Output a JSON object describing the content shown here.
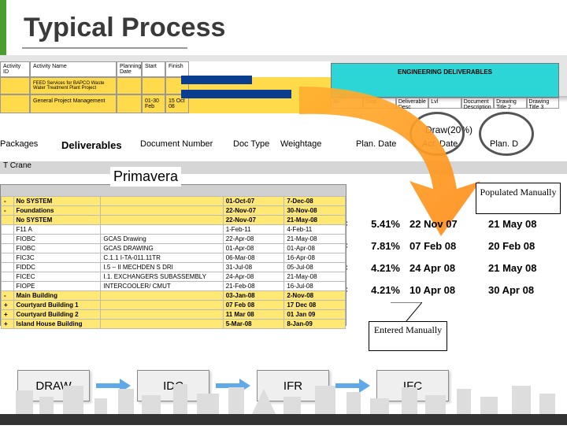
{
  "title": "Typical Process",
  "gantt": {
    "headers": [
      "Activity ID",
      "Activity Name",
      "Planning Date",
      "Start",
      "Finish"
    ],
    "rows": [
      [
        "",
        "FEED Services for BAPCO Waste Water Treatment Plant Project",
        "",
        "",
        ""
      ],
      [
        "",
        "General Project Management",
        "",
        "01-30 Feb",
        "15 Oct 08"
      ]
    ]
  },
  "cyan": {
    "title": "ENGINEERING DELIVERABLES",
    "cells": [
      "",
      "ID",
      "Disp",
      "Deliverable Desc",
      "Lvl",
      "Document Description",
      "Drawing Title 2",
      "Drawing Title 3"
    ]
  },
  "colhead": {
    "draw": "Draw(20%)",
    "cols": [
      "Packages",
      "Deliverables",
      "Document Number",
      "Doc Type",
      "Weightage",
      "Plan. Date",
      "Act. Date",
      "Plan. D"
    ]
  },
  "greyrow_label": "T Crane",
  "primavera_label": "Primavera",
  "populated_label": "Populated Manually",
  "entered_label": "Entered Manually",
  "pvwin": {
    "rows": [
      {
        "cls": "ylw",
        "cells": [
          "-",
          "No SYSTEM",
          "",
          "01-Oct-07",
          "7-Dec-08"
        ]
      },
      {
        "cls": "ylw",
        "cells": [
          "-",
          "Foundations",
          "",
          "22-Nov-07",
          "30-Nov-08"
        ]
      },
      {
        "cls": "ylw",
        "cells": [
          "",
          "No SYSTEM",
          "",
          "22-Nov-07",
          "21-May-08"
        ]
      },
      {
        "cls": "wht",
        "cells": [
          "",
          "F11 A",
          "",
          "1-Feb-11",
          "4-Feb-11"
        ]
      },
      {
        "cls": "wht",
        "cells": [
          "",
          "FIOBC",
          "GCAS Drawing",
          "22-Apr-08",
          "21-May-08"
        ]
      },
      {
        "cls": "wht",
        "cells": [
          "",
          "FIOBC",
          "GCAS DRAWING",
          "01-Apr-08",
          "01-Apr-08"
        ]
      },
      {
        "cls": "wht",
        "cells": [
          "",
          "FIC3C",
          "C.1.1 I-TA-011.11TR",
          "06-Mar-08",
          "16-Apr-08"
        ]
      },
      {
        "cls": "wht",
        "cells": [
          "",
          "FIDDC",
          "I.5 – II MECHDEN S DRI",
          "31-Jul-08",
          "05-Jul-08"
        ]
      },
      {
        "cls": "wht",
        "cells": [
          "",
          "FICEC",
          "I.1. EXCHANGERS SUBASSEMBLY",
          "24-Apr-08",
          "21-May-08"
        ]
      },
      {
        "cls": "wht",
        "cells": [
          "",
          "FIOPE",
          "INTERCOOLER/ CMUT",
          "21-Feb-08",
          "16-Jul-08"
        ]
      },
      {
        "cls": "ylw",
        "cells": [
          "-",
          "Main Building",
          "",
          "03-Jan-08",
          "2-Nov-08"
        ]
      },
      {
        "cls": "ylw",
        "cells": [
          "+",
          "Courtyard Building 1",
          "",
          "07 Feb 08",
          "17 Dec 08"
        ]
      },
      {
        "cls": "ylw",
        "cells": [
          "+",
          "Courtyard Building 2",
          "",
          "11 Mar 08",
          "01 Jan 09"
        ]
      },
      {
        "cls": "ylw",
        "cells": [
          "+",
          "Island House Building",
          "",
          "5-Mar-08",
          "8-Jan-09"
        ]
      }
    ]
  },
  "rdata": {
    "rows": [
      {
        "doc": "oc",
        "pct": "5.41%",
        "d1": "22 Nov 07",
        "d2": "21 May 08"
      },
      {
        "doc": "oc",
        "pct": "7.81%",
        "d1": "07 Feb 08",
        "d2": "20 Feb 08"
      },
      {
        "doc": "oc",
        "pct": "4.21%",
        "d1": "24 Apr 08",
        "d2": "21 May 08"
      },
      {
        "doc": "oc",
        "pct": "4.21%",
        "d1": "10 Apr 08",
        "d2": "30 Apr 08"
      }
    ]
  },
  "flow": [
    "DRAW",
    "IDC",
    "IFR",
    "IFC"
  ]
}
